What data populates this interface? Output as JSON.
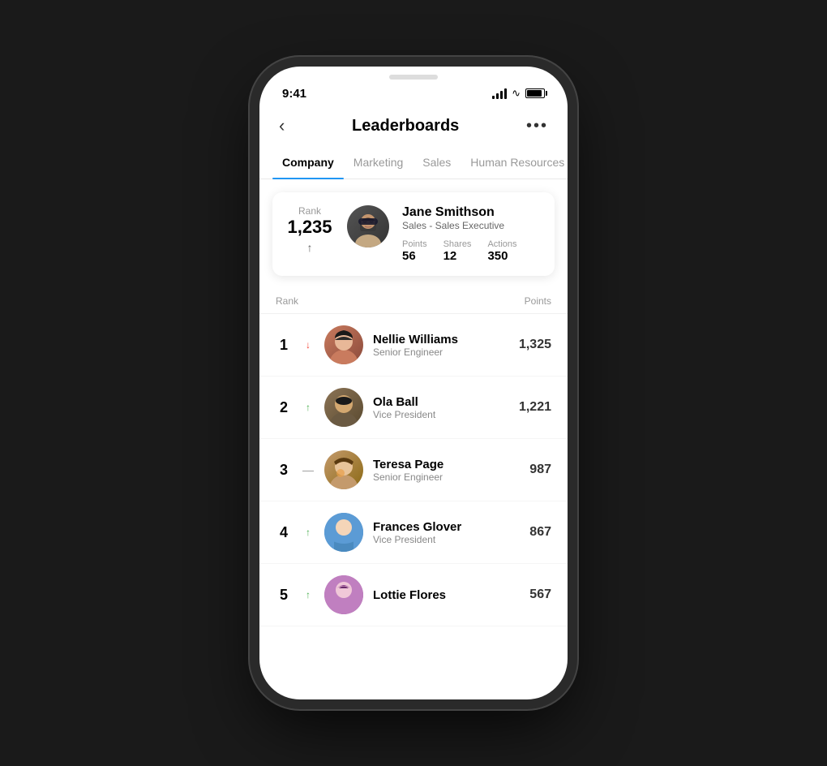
{
  "phone": {
    "time": "9:41"
  },
  "header": {
    "title": "Leaderboards",
    "back_label": "‹",
    "more_label": "•••"
  },
  "tabs": [
    {
      "id": "company",
      "label": "Company",
      "active": true
    },
    {
      "id": "marketing",
      "label": "Marketing",
      "active": false
    },
    {
      "id": "sales",
      "label": "Sales",
      "active": false
    },
    {
      "id": "hr",
      "label": "Human Resources",
      "active": false
    }
  ],
  "my_card": {
    "rank_label": "Rank",
    "rank": "1,235",
    "name": "Jane Smithson",
    "title": "Sales - Sales Executive",
    "stats": [
      {
        "label": "Points",
        "value": "56"
      },
      {
        "label": "Shares",
        "value": "12"
      },
      {
        "label": "Actions",
        "value": "350"
      }
    ]
  },
  "list_headers": {
    "rank": "Rank",
    "points": "Points"
  },
  "leaderboard": [
    {
      "rank": "1",
      "trend": "down",
      "trend_symbol": "↓",
      "name": "Nellie Williams",
      "role": "Senior Engineer",
      "points": "1,325",
      "avatar_color": "av1"
    },
    {
      "rank": "2",
      "trend": "up",
      "trend_symbol": "↑",
      "name": "Ola Ball",
      "role": "Vice President",
      "points": "1,221",
      "avatar_color": "av2"
    },
    {
      "rank": "3",
      "trend": "neutral",
      "trend_symbol": "—",
      "name": "Teresa Page",
      "role": "Senior Engineer",
      "points": "987",
      "avatar_color": "av3"
    },
    {
      "rank": "4",
      "trend": "up",
      "trend_symbol": "↑",
      "name": "Frances Glover",
      "role": "Vice President",
      "points": "867",
      "avatar_color": "av4"
    },
    {
      "rank": "5",
      "trend": "up",
      "trend_symbol": "↑",
      "name": "Lottie Flores",
      "role": "",
      "points": "567",
      "avatar_color": "av5"
    }
  ]
}
